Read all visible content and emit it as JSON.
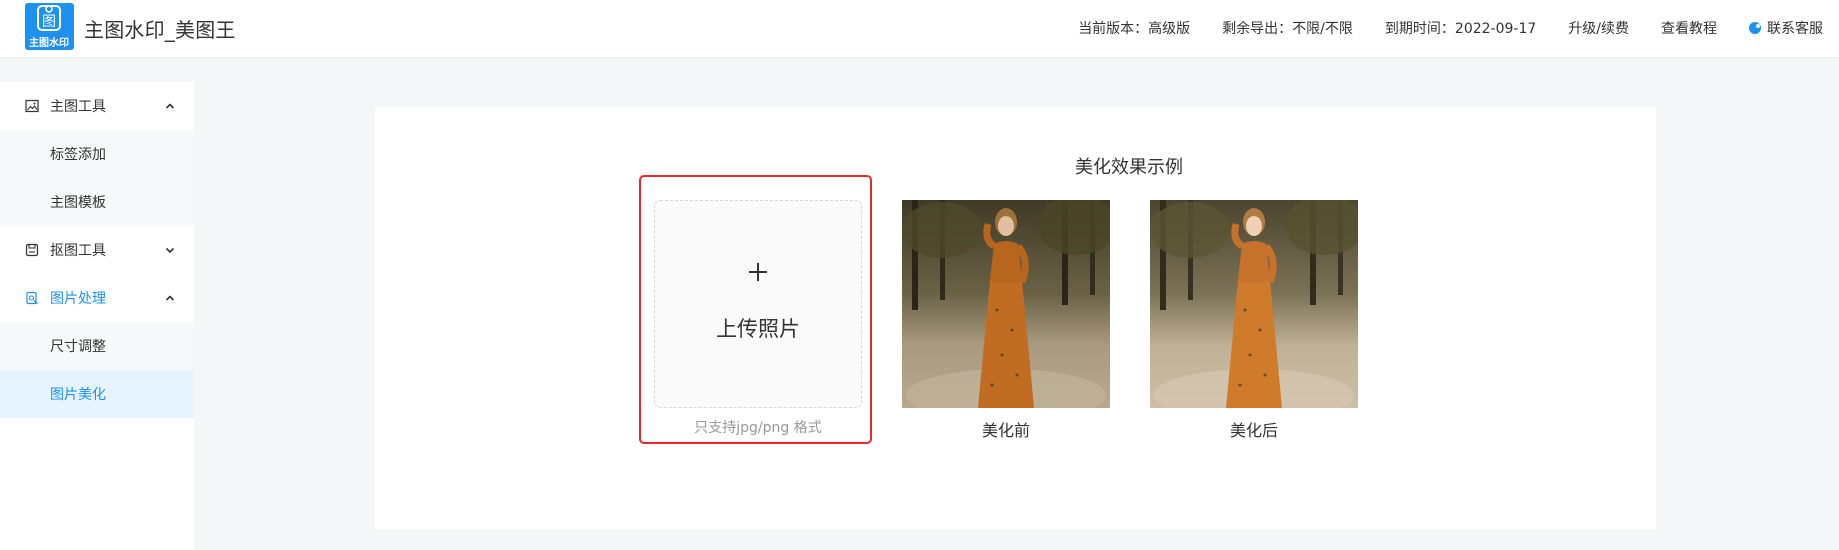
{
  "header": {
    "logo_text": "主图水印",
    "app_title": "主图水印_美图王",
    "version": "当前版本：高级版",
    "remaining": "剩余导出：不限/不限",
    "expiry": "到期时间：2022-09-17",
    "upgrade": "升级/续费",
    "tutorial": "查看教程",
    "service": "联系客服",
    "icons": {
      "logo": "image-icon",
      "service": "customer-service-icon"
    },
    "accent_color": "#1e90ef"
  },
  "sidebar": {
    "groups": [
      {
        "label": "主图工具",
        "icon": "image-icon",
        "expanded": true,
        "items": [
          {
            "label": "标签添加"
          },
          {
            "label": "主图模板"
          }
        ]
      },
      {
        "label": "抠图工具",
        "icon": "save-icon",
        "expanded": false,
        "items": []
      },
      {
        "label": "图片处理",
        "icon": "photo-edit-icon",
        "expanded": true,
        "active": true,
        "items": [
          {
            "label": "尺寸调整"
          },
          {
            "label": "图片美化",
            "selected": true
          }
        ]
      }
    ]
  },
  "main": {
    "example_title": "美化效果示例",
    "upload": {
      "label": "上传照片",
      "hint": "只支持jpg/png 格式",
      "icon": "plus-icon",
      "highlight_color": "#e8292b"
    },
    "before_caption": "美化前",
    "after_caption": "美化后"
  }
}
